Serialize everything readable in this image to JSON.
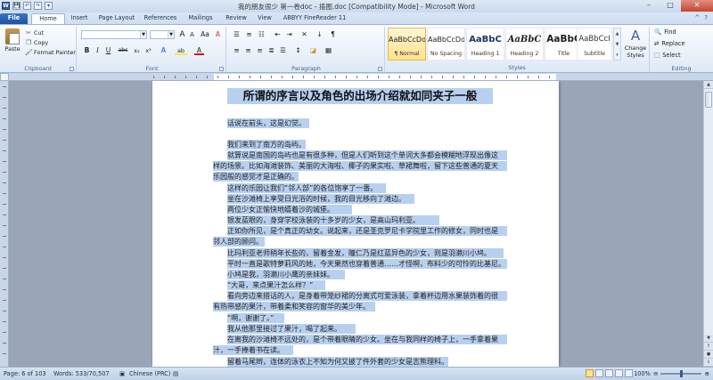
{
  "window": {
    "title": "我的朋友很少 第一卷doc - 插图.doc [Compatibility Mode] - Microsoft Word",
    "controls": {
      "minimize": "–",
      "maximize": "□",
      "close": "✕"
    }
  },
  "quick_access": [
    "W",
    "💾",
    "↶",
    "↷",
    "▾"
  ],
  "tabs": [
    {
      "label": "File"
    },
    {
      "label": "Home"
    },
    {
      "label": "Insert"
    },
    {
      "label": "Page Layout"
    },
    {
      "label": "References"
    },
    {
      "label": "Mailings"
    },
    {
      "label": "Review"
    },
    {
      "label": "View"
    },
    {
      "label": "ABBYY FineReader 11"
    }
  ],
  "help": {
    "collapse": "^",
    "help": "?"
  },
  "ribbon": {
    "clipboard": {
      "label": "Clipboard",
      "paste": "Paste",
      "cut": "Cut",
      "copy": "Copy",
      "format_painter": "Format Painter"
    },
    "font": {
      "label": "Font",
      "font_name": "",
      "font_size": "",
      "grow": "A",
      "shrink": "A",
      "case": "Aa",
      "clear": "A",
      "bold": "B",
      "italic": "I",
      "underline": "U",
      "strike": "abc",
      "subscript": "x₂",
      "superscript": "x²",
      "effects": "A",
      "highlight": "ab",
      "font_color": "A"
    },
    "paragraph": {
      "label": "Paragraph",
      "show_marks": "¶"
    },
    "styles": {
      "label": "Styles",
      "items": [
        {
          "sample": "AaBbCcDd",
          "name": "¶ Normal"
        },
        {
          "sample": "AaBbCcDd",
          "name": "No Spacing"
        },
        {
          "sample": "AaBbC",
          "name": "Heading 1"
        },
        {
          "sample": "AaBbC",
          "name": "Heading 2"
        },
        {
          "sample": "AaBbC",
          "name": "Title"
        },
        {
          "sample": "AaBbCcI",
          "name": "Subtitle"
        }
      ],
      "change_styles": "Change Styles"
    },
    "editing": {
      "label": "Editing",
      "find": "Find",
      "replace": "Replace",
      "select": "Select"
    }
  },
  "document": {
    "heading": "所谓的序言以及角色的出场介绍就如同夹子一般",
    "lines": [
      "话说在前头，这是幻觉。",
      "",
      "我们来到了南方的岛屿。",
      "就算说是南国的岛屿也是有很多种，但是人们听到这个单词大多都会模糊地浮现出像这",
      "样的场景。比如海滩装饰、美丽的大海啦、椰子的果实啦、草裙舞啦，留下这些普通的夏天",
      "乐园般的感觉才是正确的。",
      "这样的乐园让我们“邻人部”的各位饱享了一番。",
      "坐在沙滩椅上享受日光浴的时候，我的目光移向了滩边。",
      "两位少女正愉快地嬉着沙的城堡。",
      "银发蓝眼的，身穿学校泳装的十多岁的少女，是高山玛利亚。",
      "正如你所见，是个真正的幼女。说起来，还是圣克罗尼卡学院里工作的修女，同时也是",
      "邻人部的顾问。",
      "比玛利亚老师稍年长些的，留着金发，瞳仁乃是红蓝异色的少女，则是羽濑川小鸠。",
      "平时一直是歌特萝莉风的她，今天果然也穿着普通……才怪啊，布料少的可怜的比基尼。",
      "小鸠是我，羽濑川小鹰的亲妹妹。",
      "“大哥，来点果汁怎么样？”",
      "看向旁边来搭话的人，是身着带笼纱裙的分离式可爱泳装，拿着杯边用水果装饰着的很",
      "有热带感的果汁，带着柔和笑容的窗华的美少年。",
      "“啊，谢谢了。”",
      "我从他那里接过了果汁，喝了起来。",
      "在离我的沙滩椅不远处的，是个带着眼睛的少女。坐在与我同样的椅子上，一手拿着果",
      "汁，一手捧着书在读。",
      "留着马尾辫，连体的泳衣上不知为何又披了件外套的少女是志熊理科。"
    ]
  },
  "status": {
    "page": "Page: 6 of 103",
    "words": "Words: 533/70,507",
    "language": "Chinese (PRC)",
    "zoom": "100%"
  }
}
